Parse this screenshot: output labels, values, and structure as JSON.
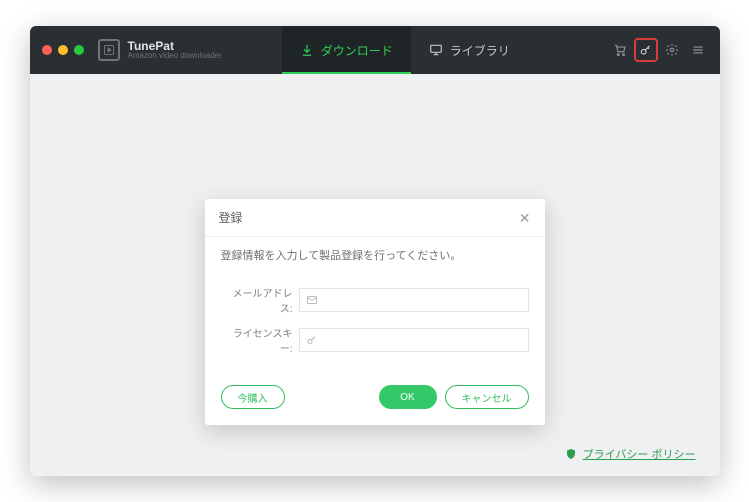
{
  "brand": {
    "name": "TunePat",
    "subtitle": "Amazon video downloader"
  },
  "tabs": {
    "download": "ダウンロード",
    "library": "ライブラリ"
  },
  "dialog": {
    "title": "登録",
    "subtitle": "登録情報を入力して製品登録を行ってください。",
    "email_label": "メールアドレス:",
    "license_label": "ライセンスキー:",
    "buy": "今購入",
    "ok": "OK",
    "cancel": "キャンセル"
  },
  "footer": {
    "privacy": "プライバシー ポリシー"
  }
}
